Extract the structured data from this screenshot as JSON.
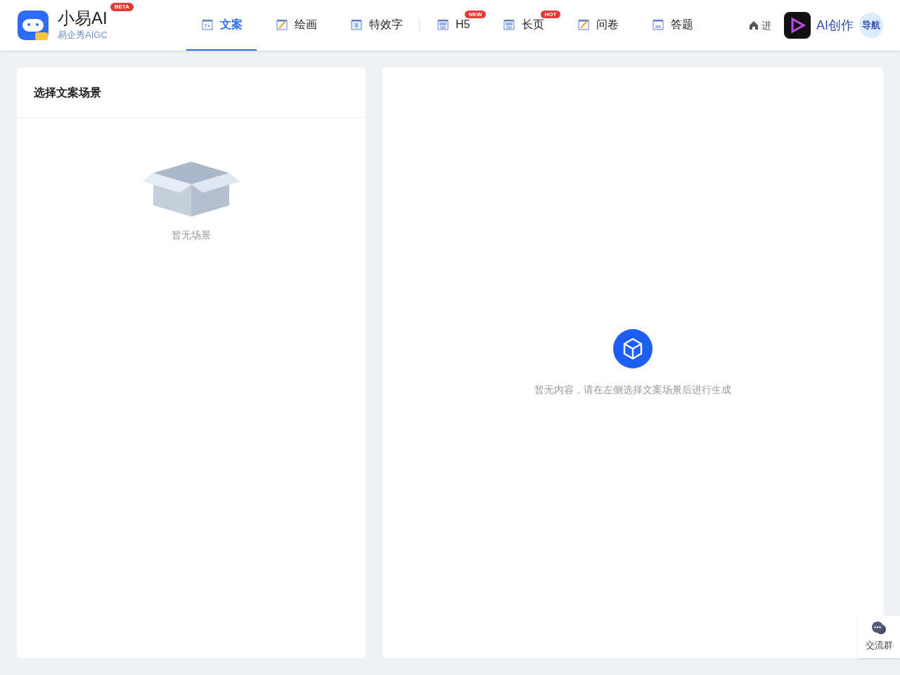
{
  "brand": {
    "name": "小易AI",
    "badge": "BETA",
    "subtitle": "易企秀AIGC"
  },
  "nav": [
    {
      "label": "文案",
      "selected": true
    },
    {
      "label": "绘画",
      "selected": false
    },
    {
      "label": "特效字",
      "selected": false,
      "divider_after": true
    },
    {
      "label": "H5",
      "selected": false,
      "badge": "NEW"
    },
    {
      "label": "长页",
      "selected": false,
      "badge": "HOT"
    },
    {
      "label": "问卷",
      "selected": false
    },
    {
      "label": "答题",
      "selected": false
    }
  ],
  "enter_link": "进",
  "overlay_logo": {
    "text": "AI创作",
    "sub": "导航"
  },
  "left_panel": {
    "title": "选择文案场景",
    "empty_text": "暂无场景"
  },
  "right_panel": {
    "empty_text": "暂无内容，请在左侧选择文案场景后进行生成"
  },
  "float_button": {
    "label": "交流群"
  }
}
